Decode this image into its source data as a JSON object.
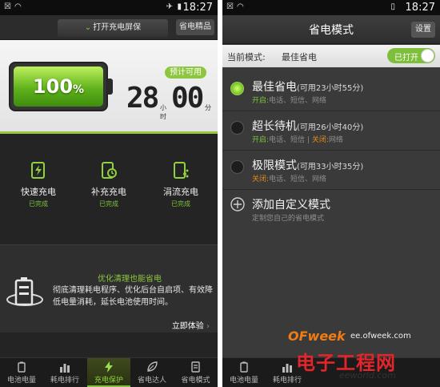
{
  "left": {
    "statusbar": {
      "time": "18:27"
    },
    "topbar": {
      "open_screen_label": "打开充电屏保",
      "elite_button": "省电精品"
    },
    "battery": {
      "percent": "100",
      "percent_sign": "%",
      "estimate_badge": "预计可用",
      "hours": "28",
      "hours_unit": "小时",
      "minutes": "00",
      "minutes_unit": "分",
      "level_fraction": 1.0
    },
    "charge_modes": [
      {
        "label": "快速充电",
        "status": "已完成",
        "icon": "fast-charge-icon"
      },
      {
        "label": "补充充电",
        "status": "已完成",
        "icon": "timer-charge-icon"
      },
      {
        "label": "涓流充电",
        "status": "已完成",
        "icon": "trickle-charge-icon"
      }
    ],
    "optimize": {
      "title": "优化清理也能省电",
      "description": "彻底清理耗电程序、优化后台自启项、有效降低电量消耗，延长电池使用时间。",
      "try_label": "立即体验"
    },
    "nav": [
      {
        "label": "电池电量",
        "icon": "battery-icon"
      },
      {
        "label": "耗电排行",
        "icon": "bar-chart-icon"
      },
      {
        "label": "充电保护",
        "icon": "lightning-icon",
        "active": true
      },
      {
        "label": "省电达人",
        "icon": "leaf-icon"
      },
      {
        "label": "省电模式",
        "icon": "mode-icon"
      }
    ]
  },
  "right": {
    "statusbar": {
      "time": "18:27"
    },
    "title": "省电模式",
    "settings_button": "设置",
    "current_mode_label": "当前模式:",
    "current_mode_value": "最佳省电",
    "toggle_label": "已打开",
    "modes": [
      {
        "name": "最佳省电",
        "detail": "(可用23小时55分)",
        "on_label": "开启:",
        "on_items": "电话、短信、网络",
        "off_label": "",
        "off_items": ""
      },
      {
        "name": "超长待机",
        "detail": "(可用26小时40分)",
        "on_label": "开启:",
        "on_items": "电话、短信 | ",
        "off_label": "关闭:",
        "off_items": "网络"
      },
      {
        "name": "极限模式",
        "detail": "(可用33小时35分)",
        "on_label": "",
        "on_items": "",
        "off_label": "关闭:",
        "off_items": "电话、短信、网络"
      }
    ],
    "custom": {
      "name": "添加自定义模式",
      "desc": "定制您自己的省电模式"
    }
  },
  "watermark": {
    "brand": "OFweek",
    "domain": "ee.ofweek.com",
    "cn": "电子工程网",
    "url": "eeworld.com"
  },
  "colors": {
    "accent_green": "#7cc23a",
    "warning_orange": "#e08a1e",
    "brand_red": "#e0262b"
  }
}
